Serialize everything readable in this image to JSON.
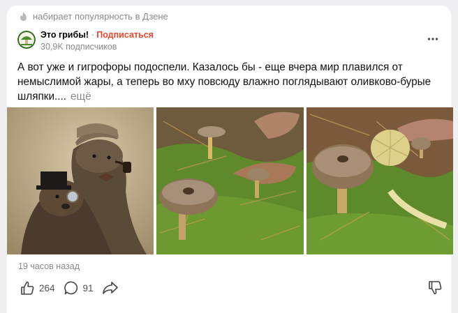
{
  "trending": {
    "icon": "flame-icon",
    "text": "набирает популярность в Дзене"
  },
  "channel": {
    "name": "Это грибы!",
    "separator": "·",
    "subscribe_label": "Подписаться",
    "subscribers": "30,9K подписчиков",
    "avatar_icon": "mushroom-avatar-icon"
  },
  "menu_icon": "more-dots-icon",
  "post": {
    "text": "А вот уже и гигрофоры подоспели. Казалось бы - еще вчера мир плавился от немыслимой жары, а теперь во мху повсюду влажно поглядывают оливково-бурые шляпки....",
    "more_label": "ещё",
    "photos": [
      "otters-photo",
      "mushrooms-photo-1",
      "mushrooms-photo-2"
    ]
  },
  "time_ago": "19 часов назад",
  "actions": {
    "likes": "264",
    "comments": "91",
    "like_icon": "thumbs-up-icon",
    "comment_icon": "comment-icon",
    "share_icon": "share-icon",
    "dislike_icon": "thumbs-down-icon"
  },
  "colors": {
    "accent": "#e8462a",
    "muted": "#8a8a8e",
    "background": "#f0f0f2"
  }
}
